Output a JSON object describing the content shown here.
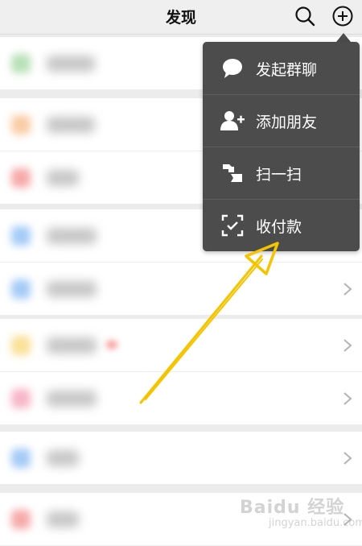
{
  "header": {
    "title": "发现"
  },
  "menu": {
    "items": [
      {
        "label": "发起群聊",
        "icon": "chat-bubble-icon"
      },
      {
        "label": "添加朋友",
        "icon": "add-friend-icon"
      },
      {
        "label": "扫一扫",
        "icon": "scan-icon"
      },
      {
        "label": "收付款",
        "icon": "money-icon"
      }
    ]
  },
  "list": {
    "rows": [
      {
        "icon": "blurred-icon",
        "color": "#7ec87e",
        "group": 1
      },
      {
        "icon": "blurred-icon",
        "color": "#f5a25a",
        "group": 2
      },
      {
        "icon": "blurred-icon",
        "color": "#f06464",
        "group": 2
      },
      {
        "icon": "blurred-icon",
        "color": "#5aa0f0",
        "group": 3
      },
      {
        "icon": "blurred-icon",
        "color": "#5aa0f0",
        "group": 3
      },
      {
        "icon": "blurred-icon",
        "color": "#f5c842",
        "group": 4
      },
      {
        "icon": "blurred-icon",
        "color": "#f07b9a",
        "group": 4
      },
      {
        "icon": "blurred-icon",
        "color": "#5aa0f0",
        "group": 5
      },
      {
        "icon": "blurred-icon",
        "color": "#f06464",
        "group": 6
      }
    ]
  },
  "annotation": {
    "arrow_color": "#f5c400"
  },
  "watermark": {
    "logo": "Baidu 经验",
    "site": "jingyan.baidu.com"
  }
}
